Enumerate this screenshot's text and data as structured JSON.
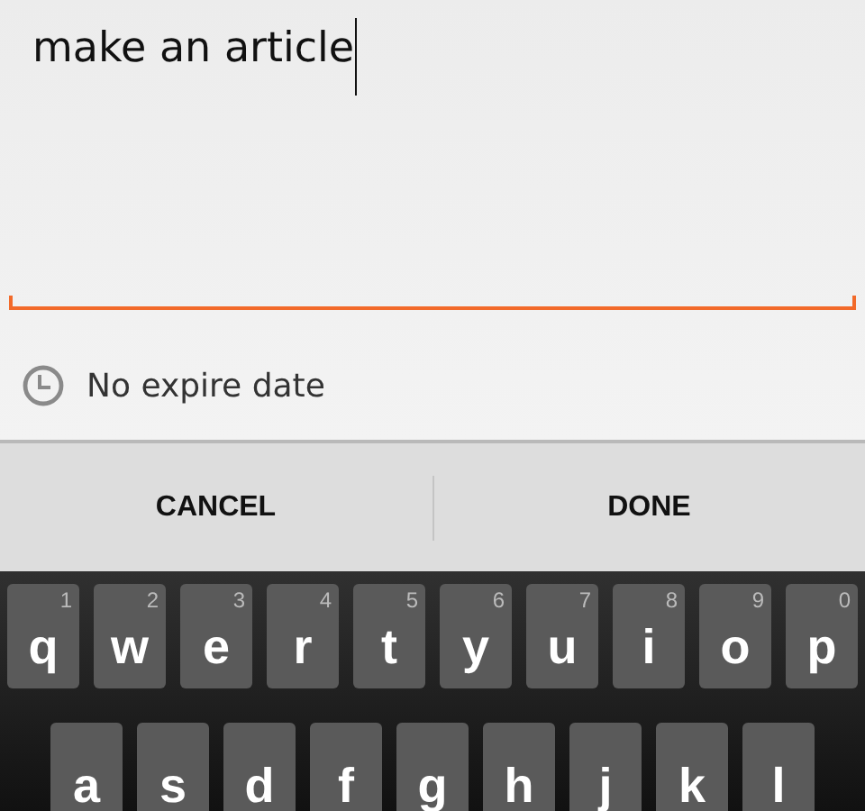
{
  "note_field": {
    "value": "make an article",
    "focused": true
  },
  "expire": {
    "label": "No expire date"
  },
  "buttons": [
    {
      "label": "CANCEL"
    },
    {
      "label": "DONE"
    }
  ],
  "keyboard": {
    "rows": [
      {
        "keys": [
          {
            "label": "q",
            "hint": "1"
          },
          {
            "label": "w",
            "hint": "2"
          },
          {
            "label": "e",
            "hint": "3"
          },
          {
            "label": "r",
            "hint": "4"
          },
          {
            "label": "t",
            "hint": "5"
          },
          {
            "label": "y",
            "hint": "6"
          },
          {
            "label": "u",
            "hint": "7"
          },
          {
            "label": "i",
            "hint": "8"
          },
          {
            "label": "o",
            "hint": "9"
          },
          {
            "label": "p",
            "hint": "0"
          }
        ]
      },
      {
        "keys": [
          {
            "label": "a"
          },
          {
            "label": "s"
          },
          {
            "label": "d"
          },
          {
            "label": "f"
          },
          {
            "label": "g"
          },
          {
            "label": "h"
          },
          {
            "label": "j"
          },
          {
            "label": "k"
          },
          {
            "label": "l"
          }
        ]
      }
    ]
  }
}
